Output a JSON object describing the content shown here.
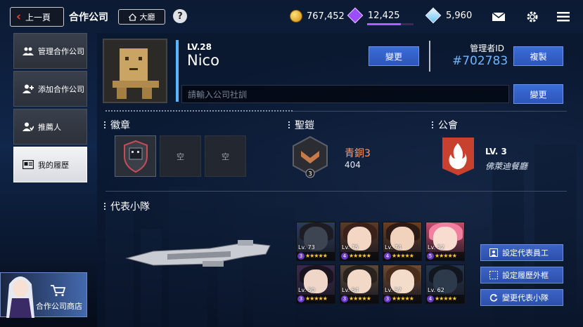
{
  "topbar": {
    "back_label": "上一頁",
    "title": "合作公司",
    "lobby_label": "大廳",
    "help_label": "?",
    "credits": "767,452",
    "gems": "12,425",
    "gems_progress": 0.72,
    "crystals": "5,960",
    "icons": [
      "coin-icon",
      "purple-gem-icon",
      "blue-gem-icon",
      "mail-icon",
      "settings-icon",
      "menu-icon"
    ]
  },
  "sidebar": {
    "items": [
      {
        "label": "管理合作公司",
        "icon": "people-icon"
      },
      {
        "label": "添加合作公司",
        "icon": "add-person-icon"
      },
      {
        "label": "推薦人",
        "icon": "recommend-icon"
      },
      {
        "label": "我的履歷",
        "icon": "profile-card-icon",
        "active": true
      }
    ],
    "shop_label": "合作公司商店"
  },
  "profile": {
    "level": "LV.28",
    "name": "Nico",
    "change_label": "變更",
    "admin_id_label": "管理者ID",
    "admin_id": "#702783",
    "copy_label": "複製",
    "motto_placeholder": "請輸入公司社訓",
    "motto_change_label": "變更"
  },
  "badges": {
    "title": "徽章",
    "empty_label_1": "空",
    "empty_label_2": "空"
  },
  "rank": {
    "title": "聖鎧",
    "tier_name": "青銅3",
    "tier_number": "3",
    "score": "404"
  },
  "guild": {
    "title": "公會",
    "level": "LV. 3",
    "name": "佛萊迪餐廳"
  },
  "squad": {
    "title": "代表小隊",
    "members": [
      {
        "lv": "Lv. 73",
        "burst": "3",
        "stars": "★★★★★"
      },
      {
        "lv": "Lv. 75",
        "burst": "4",
        "stars": "★★★★★"
      },
      {
        "lv": "Lv. 74",
        "burst": "4",
        "stars": "★★★★★"
      },
      {
        "lv": "Lv. 52",
        "burst": "5",
        "stars": "★★★★★"
      },
      {
        "lv": "Lv. 50",
        "burst": "3",
        "stars": "★★★★★"
      },
      {
        "lv": "Lv. 64",
        "burst": "3",
        "stars": "★★★★★"
      },
      {
        "lv": "Lv. 57",
        "burst": "3",
        "stars": "★★★★★"
      },
      {
        "lv": "Lv. 62",
        "burst": "4",
        "stars": "★★★★★"
      }
    ],
    "actions": {
      "set_rep_label": "設定代表員工",
      "set_frame_label": "設定履歷外框",
      "change_squad_label": "變更代表小隊"
    }
  }
}
